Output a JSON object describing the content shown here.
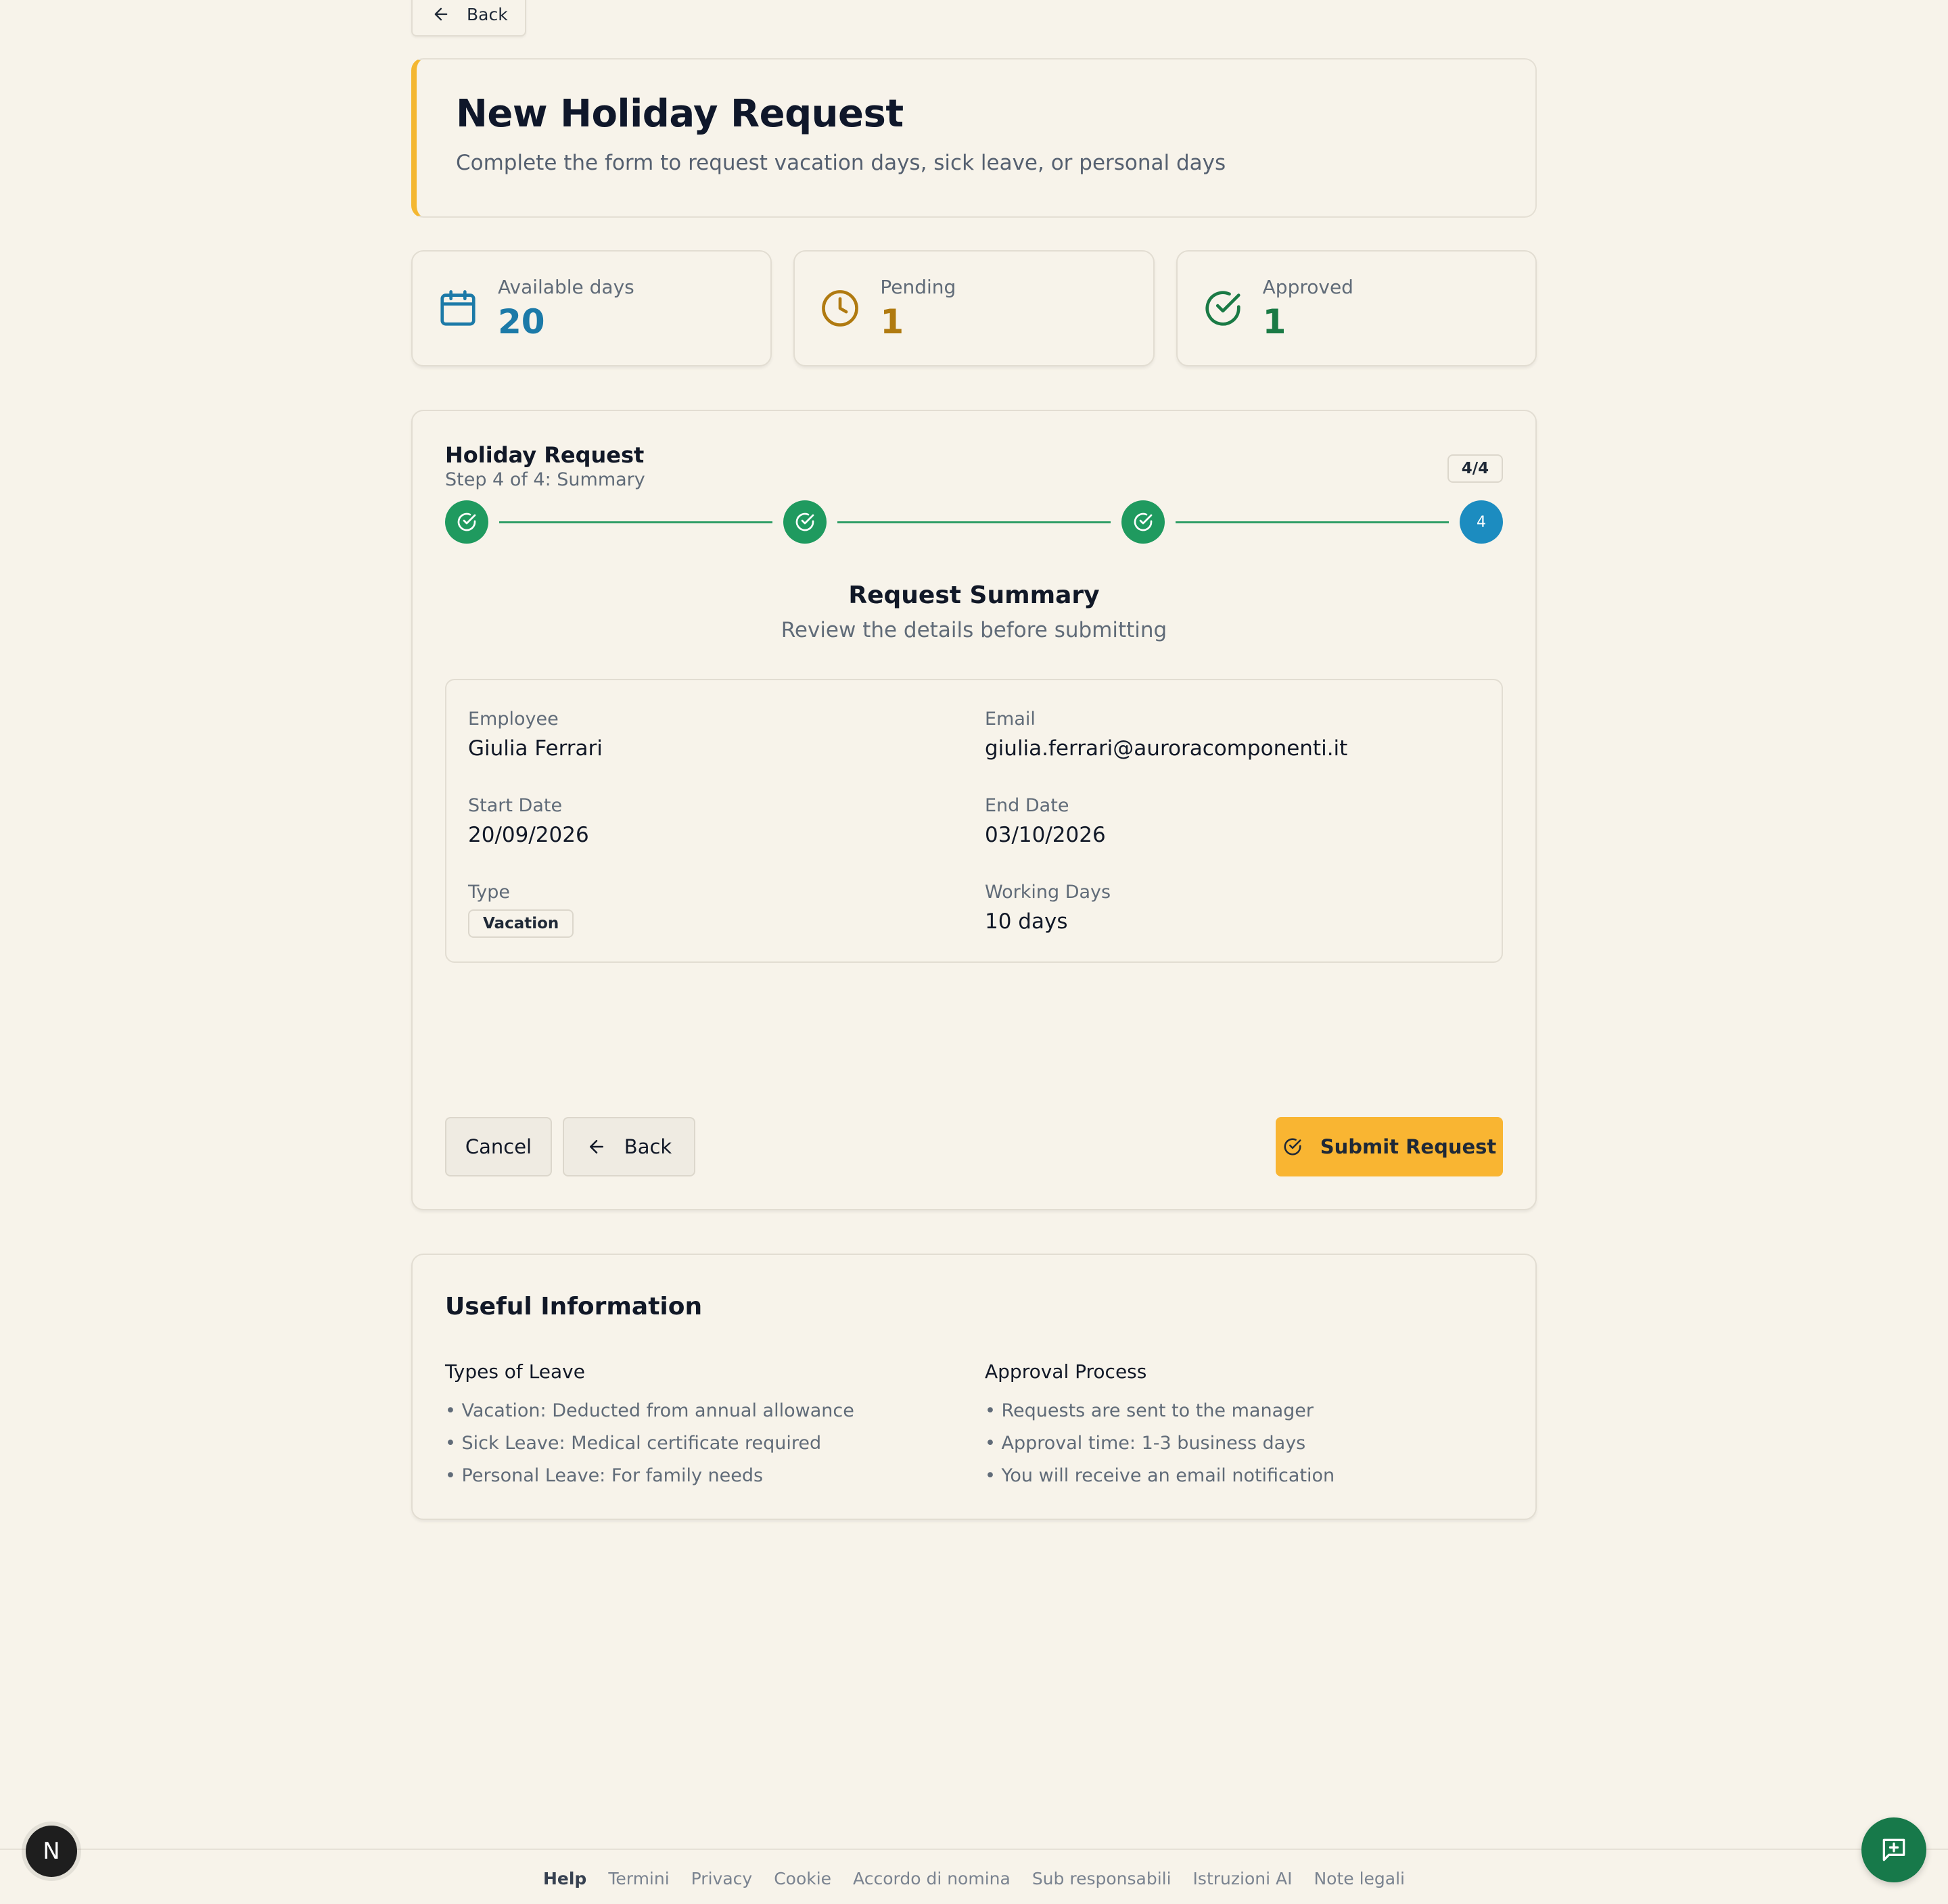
{
  "nav": {
    "back_label": "Back"
  },
  "header": {
    "title": "New Holiday Request",
    "subtitle": "Complete the form to request vacation days, sick leave, or personal days"
  },
  "stats": [
    {
      "label": "Available days",
      "value": "20",
      "icon": "calendar-icon",
      "color": "#1c7aa8"
    },
    {
      "label": "Pending",
      "value": "1",
      "icon": "clock-icon",
      "color": "#b07a10"
    },
    {
      "label": "Approved",
      "value": "1",
      "icon": "check-circle-icon",
      "color": "#1a7a45"
    }
  ],
  "wizard": {
    "title": "Holiday Request",
    "subtitle": "Step 4 of 4: Summary",
    "badge": "4/4",
    "current_step_label": "4",
    "summary_title": "Request Summary",
    "summary_subtitle": "Review the details before submitting",
    "details": {
      "employee_label": "Employee",
      "employee": "Giulia Ferrari",
      "email_label": "Email",
      "email": "giulia.ferrari@auroracomponenti.it",
      "start_label": "Start Date",
      "start": "20/09/2026",
      "end_label": "End Date",
      "end": "03/10/2026",
      "type_label": "Type",
      "type": "Vacation",
      "days_label": "Working Days",
      "days": "10 days"
    },
    "cancel_label": "Cancel",
    "back_label": "Back",
    "submit_label": "Submit Request"
  },
  "info": {
    "title": "Useful Information",
    "types_title": "Types of Leave",
    "types": [
      "• Vacation: Deducted from annual allowance",
      "• Sick Leave: Medical certificate required",
      "• Personal Leave: For family needs"
    ],
    "approval_title": "Approval Process",
    "approval": [
      "• Requests are sent to the manager",
      "• Approval time: 1-3 business days",
      "• You will receive an email notification"
    ]
  },
  "footer": {
    "links": [
      "Help",
      "Termini",
      "Privacy",
      "Cookie",
      "Accordo di nomina",
      "Sub responsabili",
      "Istruzioni AI",
      "Note legali"
    ]
  },
  "n_badge": "N",
  "colors": {
    "accent": "#f4b731",
    "success": "#1f9a5f",
    "info": "#1c8cc0",
    "primary_button": "#f9b532",
    "chat": "#17794a"
  }
}
